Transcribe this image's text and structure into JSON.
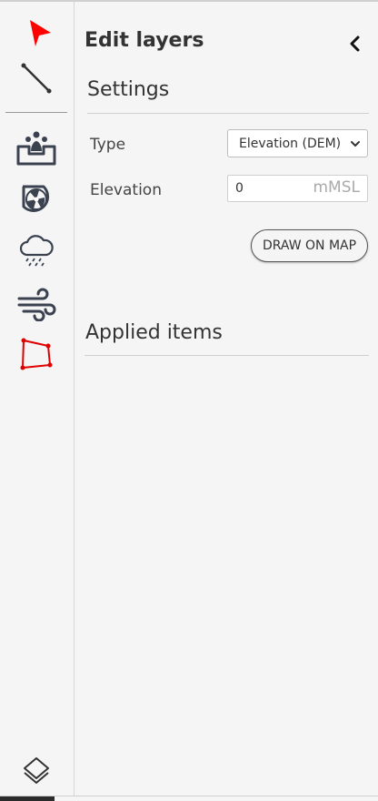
{
  "toolbar": {
    "tools": [
      {
        "name": "select-arrow",
        "icon": "cursor-arrow-icon",
        "color": "#ff0000"
      },
      {
        "name": "line",
        "icon": "line-tool-icon",
        "color": "#333333"
      },
      {
        "name": "source",
        "icon": "fountain-source-icon",
        "color": "#3a4250"
      },
      {
        "name": "fan",
        "icon": "fan-icon",
        "color": "#3a4250"
      },
      {
        "name": "rain",
        "icon": "rain-cloud-icon",
        "color": "#3a4250"
      },
      {
        "name": "wind",
        "icon": "wind-icon",
        "color": "#3a4250"
      },
      {
        "name": "polygon",
        "icon": "polygon-icon",
        "color": "#e00000"
      }
    ],
    "layers_icon": "layers-icon"
  },
  "panel": {
    "title": "Edit layers",
    "collapse_icon": "chevron-left-icon",
    "settings": {
      "heading": "Settings",
      "type_label": "Type",
      "type_value": "Elevation (DEM)",
      "elevation_label": "Elevation",
      "elevation_value": "0",
      "elevation_unit": "mMSL",
      "draw_button": "DRAW ON MAP"
    },
    "applied": {
      "heading": "Applied items",
      "items": []
    }
  },
  "colors": {
    "accent_red": "#ff0000",
    "icon_dark": "#3a4250",
    "background": "#f5f5f5"
  }
}
